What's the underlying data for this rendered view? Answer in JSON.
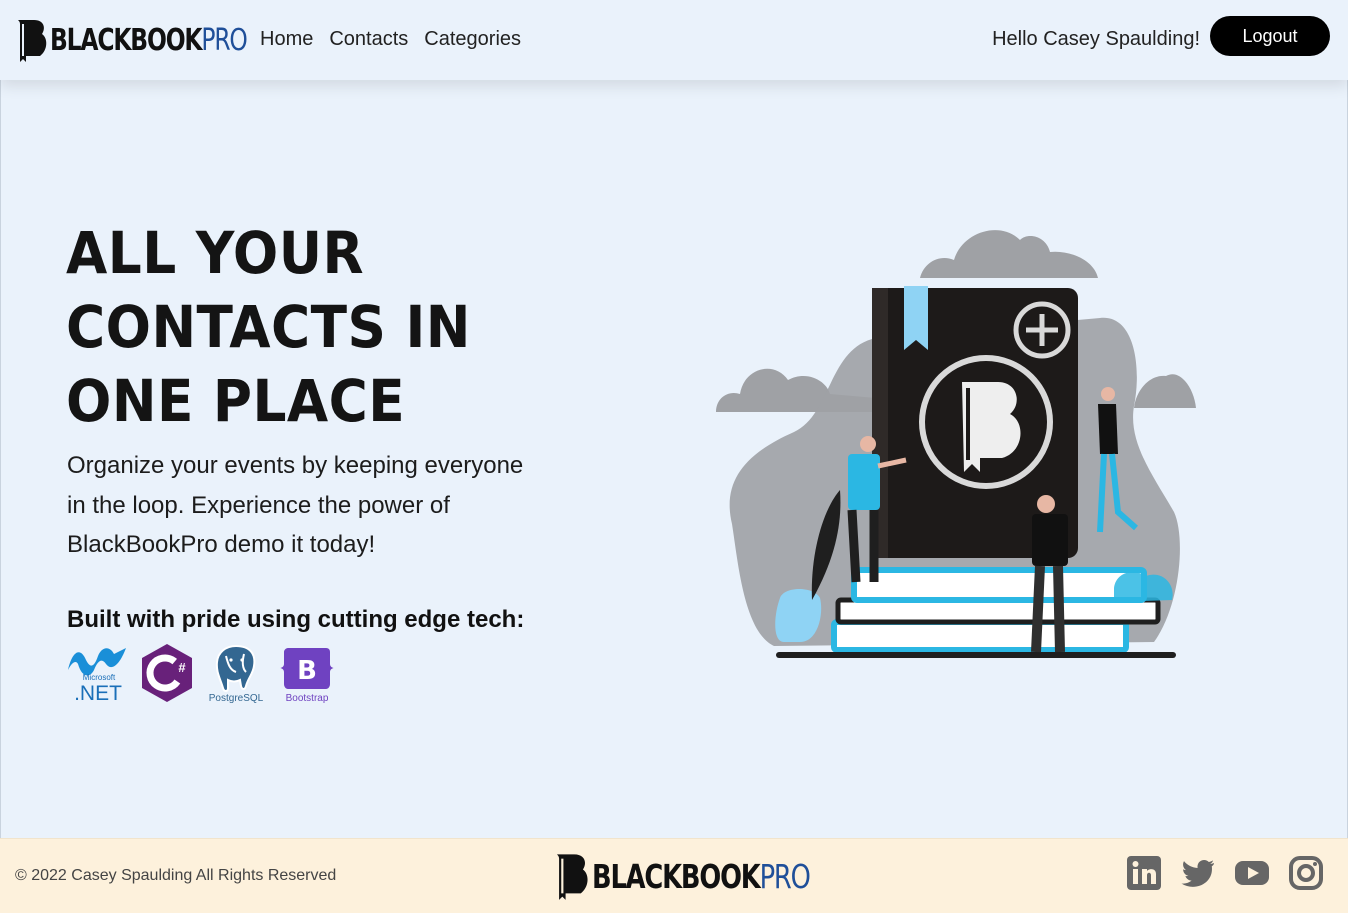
{
  "navbar": {
    "brand": {
      "part1": "BLACKBOOK",
      "part2": "PRO"
    },
    "links": [
      {
        "label": "Home"
      },
      {
        "label": "Contacts"
      },
      {
        "label": "Categories"
      }
    ],
    "greeting": "Hello Casey Spaulding!",
    "logout_label": "Logout"
  },
  "hero": {
    "title_lines": [
      "ALL YOUR",
      "CONTACTS IN",
      "ONE PLACE"
    ],
    "subtitle": "Organize your events by keeping everyone in the loop. Experience the power of BlackBookPro demo it today!",
    "tech_title": "Built with pride using cutting edge tech:",
    "tech": [
      {
        "name": "dotnet-logo",
        "caption_small": "Microsoft",
        "caption": ".NET"
      },
      {
        "name": "csharp-logo",
        "caption": "C#"
      },
      {
        "name": "postgresql-logo",
        "caption": "PostgreSQL"
      },
      {
        "name": "bootstrap-logo",
        "letter": "B",
        "caption": "Bootstrap"
      }
    ]
  },
  "footer": {
    "copyright": "© 2022 Casey Spaulding All Rights Reserved",
    "brand": {
      "part1": "BLACKBOOK",
      "part2": "PRO"
    },
    "social": [
      "linkedin-icon",
      "twitter-icon",
      "youtube-icon",
      "instagram-icon"
    ]
  },
  "colors": {
    "background": "#eaf2fb",
    "footer_bg": "#fdf1dc",
    "brand_blue": "#1f4f99",
    "accent_cyan": "#2bb7e3",
    "cloud_gray": "#9fa1a5"
  }
}
